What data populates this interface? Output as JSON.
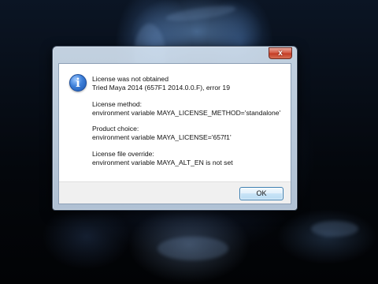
{
  "dialog": {
    "close_glyph": "x",
    "icon": "info-icon",
    "lines": [
      [
        "License was not obtained",
        "Tried Maya 2014 (657F1 2014.0.0.F), error 19"
      ],
      [
        "License method:",
        "environment variable MAYA_LICENSE_METHOD='standalone'"
      ],
      [
        "Product choice:",
        "environment variable MAYA_LICENSE='657f1'"
      ],
      [
        "License file override:",
        "environment variable MAYA_ALT_EN is not set"
      ]
    ],
    "ok_label": "OK"
  },
  "colors": {
    "close_button": "#c23a22",
    "info_icon": "#3d7fd8",
    "ok_border": "#3c7fb1"
  }
}
